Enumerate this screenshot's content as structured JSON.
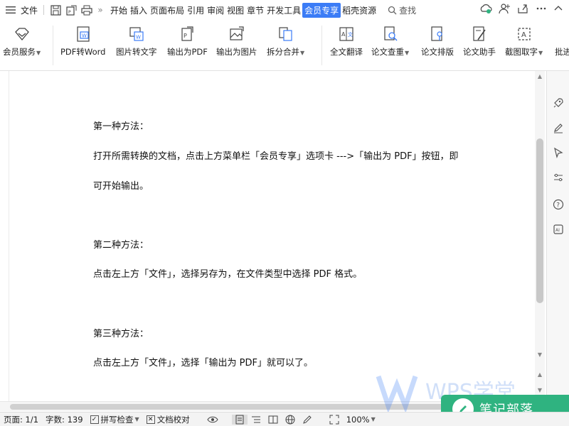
{
  "menubar": {
    "hamburger_icon": "menu-icon",
    "file_label": "文件",
    "tabs": [
      "开始",
      "插入",
      "页面布局",
      "引用",
      "审阅",
      "视图",
      "章节",
      "开发工具",
      "会员专享",
      "稻壳资源"
    ],
    "active_tab": "会员专享",
    "search_label": "查找"
  },
  "ribbon": {
    "buttons": [
      {
        "label": "会员服务",
        "icon": "diamond-icon"
      },
      {
        "label": "PDF转Word",
        "icon": "pdf-to-word-icon"
      },
      {
        "label": "图片转文字",
        "icon": "image-to-text-icon"
      },
      {
        "label": "输出为PDF",
        "icon": "export-pdf-icon"
      },
      {
        "label": "输出为图片",
        "icon": "export-image-icon"
      },
      {
        "label": "拆分合并",
        "icon": "split-merge-icon"
      },
      {
        "label": "全文翻译",
        "icon": "translate-icon"
      },
      {
        "label": "论文查重",
        "icon": "plagiarism-check-icon"
      },
      {
        "label": "论文排版",
        "icon": "paper-layout-icon"
      },
      {
        "label": "论文助手",
        "icon": "paper-assistant-icon"
      },
      {
        "label": "截图取字",
        "icon": "screenshot-text-icon"
      },
      {
        "label": "批进"
      }
    ]
  },
  "document": {
    "paragraphs": [
      "第一种方法：",
      "打开所需转换的文档，点击上方菜单栏「会员专享」选项卡 --->「输出为 PDF」按钮，即",
      "可开始输出。",
      "第二种方法：",
      "点击左上方「文件」，选择另存为，在文件类型中选择 PDF 格式。",
      "第三种方法：",
      "点击左上方「文件」，选择「输出为 PDF」就可以了。"
    ]
  },
  "statusbar": {
    "page": "页面: 1/1",
    "words": "字数: 139",
    "spellcheck": "拼写检查",
    "proofread": "文档校对",
    "zoom": "100%"
  },
  "watermark": {
    "wps_text": "WPS学堂",
    "badge_text": "笔记部落"
  },
  "colors": {
    "accent": "#3b7cf6",
    "badge": "#2fb380"
  }
}
